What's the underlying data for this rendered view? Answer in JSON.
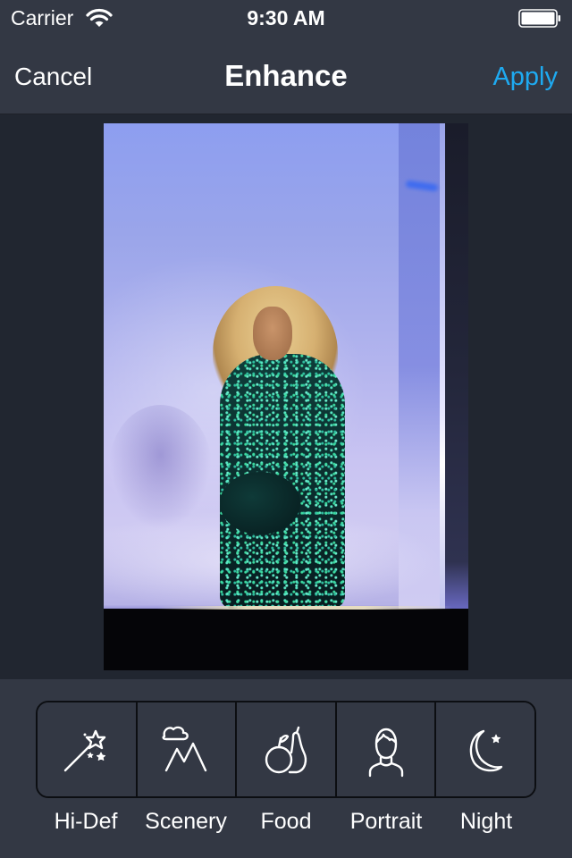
{
  "status_bar": {
    "carrier": "Carrier",
    "time": "9:30 AM",
    "icons": [
      "wifi-icon",
      "battery-icon"
    ]
  },
  "nav": {
    "cancel_label": "Cancel",
    "title": "Enhance",
    "apply_label": "Apply",
    "accent_color": "#1eaaf1"
  },
  "photo": {
    "description": "Performer in green sequined gown kneeling on stage with microphone, blue-lit backdrop and fog"
  },
  "toolbar": {
    "options": [
      {
        "id": "hi-def",
        "label": "Hi-Def",
        "icon": "magic-wand-icon"
      },
      {
        "id": "scenery",
        "label": "Scenery",
        "icon": "mountain-cloud-icon"
      },
      {
        "id": "food",
        "label": "Food",
        "icon": "apple-pear-icon"
      },
      {
        "id": "portrait",
        "label": "Portrait",
        "icon": "person-icon"
      },
      {
        "id": "night",
        "label": "Night",
        "icon": "moon-star-icon"
      }
    ]
  },
  "colors": {
    "bar_background": "#333844",
    "content_background": "#212630",
    "text": "#ffffff"
  }
}
